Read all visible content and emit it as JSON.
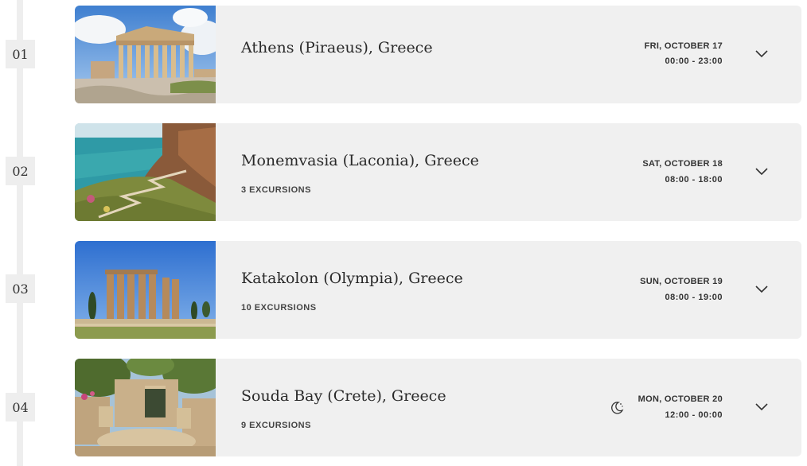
{
  "itinerary": [
    {
      "day": "01",
      "port": "Athens (Piraeus), Greece",
      "excursions": "",
      "date": "FRI, OCTOBER 17",
      "time": "00:00 - 23:00",
      "overnight": false,
      "image": "parthenon-acropolis"
    },
    {
      "day": "02",
      "port": "Monemvasia (Laconia), Greece",
      "excursions": "3 EXCURSIONS",
      "date": "SAT, OCTOBER 18",
      "time": "08:00 - 18:00",
      "overnight": false,
      "image": "coastal-cliff-path"
    },
    {
      "day": "03",
      "port": "Katakolon (Olympia), Greece",
      "excursions": "10 EXCURSIONS",
      "date": "SUN, OCTOBER 19",
      "time": "08:00 - 19:00",
      "overnight": false,
      "image": "temple-of-zeus-columns"
    },
    {
      "day": "04",
      "port": "Souda Bay (Crete), Greece",
      "excursions": "9 EXCURSIONS",
      "date": "MON, OCTOBER 20",
      "time": "12:00 - 00:00",
      "overnight": true,
      "image": "stone-ruins-courtyard"
    }
  ],
  "icons": {
    "expand": "chevron-down-icon",
    "overnight": "moon-icon"
  },
  "colors": {
    "card_bg": "#f0f0f0",
    "timeline": "#eeeeee",
    "text": "#2a2a2a"
  }
}
